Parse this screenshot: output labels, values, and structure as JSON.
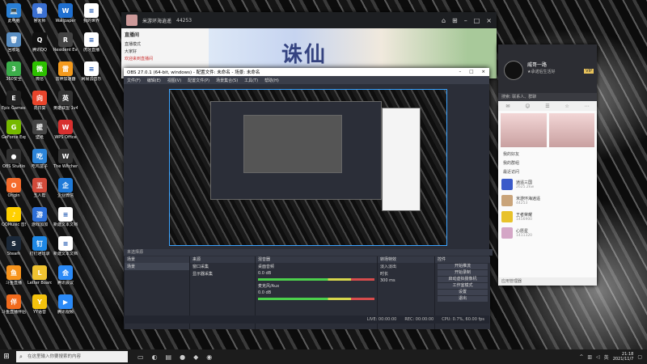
{
  "desktop_icons": [
    {
      "label": "此电脑",
      "color": "#2a7fd4",
      "glyph": "💻"
    },
    {
      "label": "回收站",
      "color": "#5a8fc4",
      "glyph": "🗑"
    },
    {
      "label": "360安全",
      "color": "#3cae4a",
      "glyph": "3"
    },
    {
      "label": "Epic Games Launcher",
      "color": "#222",
      "glyph": "E"
    },
    {
      "label": "GeForce Experience",
      "color": "#76b900",
      "glyph": "G"
    },
    {
      "label": "OBS Studio",
      "color": "#303030",
      "glyph": "●"
    },
    {
      "label": "Origin",
      "color": "#f56c2d",
      "glyph": "O"
    },
    {
      "label": "QQMusic 音乐",
      "color": "#ffd000",
      "glyph": "♪"
    },
    {
      "label": "Steam",
      "color": "#1b2838",
      "glyph": "S"
    },
    {
      "label": "斗鱼直播",
      "color": "#f7941d",
      "glyph": "鱼"
    },
    {
      "label": "斗鱼直播伴侣",
      "color": "#f26b1d",
      "glyph": "伴"
    },
    {
      "label": "鲁大师",
      "color": "#3a6fd1",
      "glyph": "鲁"
    },
    {
      "label": "腾讯QQ",
      "color": "#111",
      "glyph": "Q"
    },
    {
      "label": "微信",
      "color": "#2dc100",
      "glyph": "微"
    },
    {
      "label": "向日葵",
      "color": "#e8442b",
      "glyph": "向"
    },
    {
      "label": "壁纸",
      "color": "#444",
      "glyph": "壁"
    },
    {
      "label": "吃鸡盒子",
      "color": "#2c84d8",
      "glyph": "吃"
    },
    {
      "label": "五人帮",
      "color": "#d24a3a",
      "glyph": "五"
    },
    {
      "label": "游戏加加",
      "color": "#2d6fd8",
      "glyph": "游"
    },
    {
      "label": "钉钉通讯录",
      "color": "#1e88e5",
      "glyph": "钉"
    },
    {
      "label": "Letter Board",
      "color": "#f0c330",
      "glyph": "L"
    },
    {
      "label": "YY语音",
      "color": "#f4c20d",
      "glyph": "Y"
    },
    {
      "label": "Wallpaper",
      "color": "#1f6fd0",
      "glyph": "W"
    },
    {
      "label": "Resident Evil Villa",
      "color": "#444",
      "glyph": "R"
    },
    {
      "label": "雷神加速器",
      "color": "#f49a1d",
      "glyph": "雷"
    },
    {
      "label": "英雄联盟 1v4",
      "color": "#333",
      "glyph": "英"
    },
    {
      "label": "WPS Office",
      "color": "#d8302f",
      "glyph": "W"
    },
    {
      "label": "The Witcher 3 Wild Hu...",
      "color": "#333",
      "glyph": "W"
    },
    {
      "label": "企业微信",
      "color": "#1f7ad8",
      "glyph": "企"
    },
    {
      "label": "新建文本文档",
      "color": "#fff",
      "glyph": "≡"
    },
    {
      "label": "新建文本文档 (2)",
      "color": "#fff",
      "glyph": "≡"
    },
    {
      "label": "腾讯会议",
      "color": "#2b8af7",
      "glyph": "会"
    },
    {
      "label": "腾讯视频",
      "color": "#2b8af7",
      "glyph": "▶"
    },
    {
      "label": "我的世界",
      "color": "#fff",
      "glyph": "≡"
    },
    {
      "label": "虎牙直播",
      "color": "#fff",
      "glyph": "≡"
    },
    {
      "label": "网易云音乐",
      "color": "#fff",
      "glyph": "≡"
    }
  ],
  "browser": {
    "channel_title": "米游环海逍遥",
    "viewer_count": "44253",
    "side_header": "直播间",
    "side_items": [
      "直播模式",
      "大家好",
      "欢迎来到直播间"
    ],
    "banner_text": "诛仙"
  },
  "obs": {
    "title": "OBS 27.0.1 (64-bit, windows) - 配置文件: 未命名 - 场景: 未命名",
    "menu": [
      "文件(F)",
      "编辑(E)",
      "视图(V)",
      "配置文件(P)",
      "场景集合(S)",
      "工具(T)",
      "帮助(H)"
    ],
    "scenes_header": "场景",
    "scenes": [
      "场景"
    ],
    "sources_header": "来源",
    "sources": [
      "窗口采集",
      "显示器采集"
    ],
    "mixer_header": "混音器",
    "mixer": [
      {
        "name": "桌面音频",
        "db": "0.0 dB"
      },
      {
        "name": "麦克风/Aux",
        "db": "0.0 dB"
      }
    ],
    "transitions_header": "转场特效",
    "transition_type": "淡入淡出",
    "duration_label": "时长",
    "duration": "300 ms",
    "controls_header": "控件",
    "controls": [
      "开始推流",
      "开始录制",
      "启动虚拟摄像机",
      "工作室模式",
      "设置",
      "退出"
    ],
    "source_selected": "未选择源",
    "status": [
      "LIVE: 00:00:00",
      "REC: 00:00:00",
      "CPU: 0.7%, 60.00 fps"
    ]
  },
  "chat": {
    "name": "威哥一路",
    "signature": "★承诺后生活好",
    "tag": "VIP",
    "search_placeholder": "搜索: 联系人、群聊",
    "groups": [
      "我的好友",
      "我的群组",
      "最近访问"
    ],
    "friends": [
      {
        "name": "逍遥三国",
        "status": "2625.2kw"
      },
      {
        "name": "米游环海逍遥",
        "status": "44253"
      },
      {
        "name": "王者荣耀",
        "status": "1456900"
      },
      {
        "name": "心愿星",
        "status": "1411320"
      }
    ],
    "bottom_label": "应用管理器"
  },
  "taskbar": {
    "search_placeholder": "在这里输入你要搜索的内容",
    "time": "21:18",
    "date": "2021/11/7",
    "lang": "英"
  }
}
